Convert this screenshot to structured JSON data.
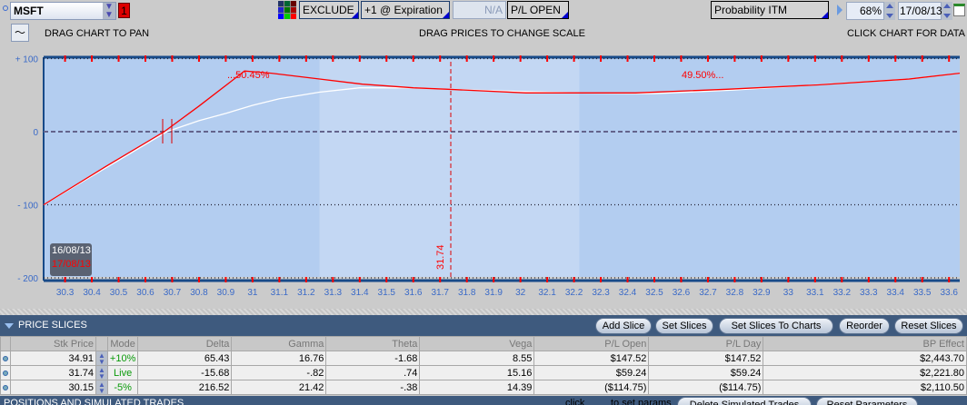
{
  "toolbar": {
    "symbol": "MSFT",
    "badge": "1",
    "exclude": "EXCLUDE",
    "expiration": "+1 @ Expiration",
    "na": "N/A",
    "pl_mode": "P/L OPEN",
    "prob": "Probability ITM",
    "pct": "68%",
    "date": "17/08/13"
  },
  "hints": {
    "pan": "DRAG CHART TO PAN",
    "scale": "DRAG PRICES TO CHANGE SCALE",
    "data": "CLICK CHART FOR DATA"
  },
  "chart_data": {
    "type": "line",
    "xlim": [
      30.22,
      33.64
    ],
    "ylim": [
      -200,
      100
    ],
    "x_ticks": [
      "30.3",
      "30.4",
      "30.5",
      "30.6",
      "30.7",
      "30.8",
      "30.9",
      "31",
      "31.1",
      "31.2",
      "31.3",
      "31.4",
      "31.5",
      "31.6",
      "31.7",
      "31.8",
      "31.9",
      "32",
      "32.1",
      "32.2",
      "32.3",
      "32.4",
      "32.5",
      "32.6",
      "32.7",
      "32.8",
      "32.9",
      "33",
      "33.1",
      "33.2",
      "33.3",
      "33.4",
      "33.5",
      "33.6"
    ],
    "y_ticks": [
      {
        "v": 100,
        "label": "+ 100"
      },
      {
        "v": 0,
        "label": "0"
      },
      {
        "v": -100,
        "label": "- 100"
      },
      {
        "v": -200,
        "label": "- 200"
      }
    ],
    "prob_range": [
      31.25,
      32.22
    ],
    "current_price": 31.74,
    "current_price_label": "31.74",
    "prob_left_label": "...50.45%",
    "prob_right_label": "49.50%...",
    "legend": [
      "16/08/13",
      "17/08/13"
    ],
    "series": [
      {
        "name": "16/08/13",
        "color": "#ffffff",
        "points": [
          [
            30.22,
            -100
          ],
          [
            30.45,
            -50
          ],
          [
            30.68,
            0
          ],
          [
            30.8,
            15
          ],
          [
            30.9,
            25
          ],
          [
            31.0,
            36
          ],
          [
            31.1,
            45
          ],
          [
            31.25,
            54
          ],
          [
            31.4,
            60
          ],
          [
            31.6,
            60
          ],
          [
            31.73,
            58
          ],
          [
            32.0,
            55
          ],
          [
            32.2,
            53
          ],
          [
            32.5,
            52
          ],
          [
            32.8,
            57
          ],
          [
            33.1,
            64
          ],
          [
            33.45,
            72
          ],
          [
            33.64,
            80
          ]
        ]
      },
      {
        "name": "17/08/13",
        "color": "#ff0000",
        "points": [
          [
            30.22,
            -100
          ],
          [
            30.45,
            -48
          ],
          [
            30.67,
            0
          ],
          [
            30.8,
            35
          ],
          [
            30.97,
            83
          ],
          [
            31.07,
            80
          ],
          [
            31.25,
            72
          ],
          [
            31.41,
            65
          ],
          [
            31.6,
            60
          ],
          [
            31.73,
            58
          ],
          [
            32.02,
            53
          ],
          [
            32.43,
            53
          ],
          [
            32.77,
            58
          ],
          [
            33.11,
            64
          ],
          [
            33.45,
            72
          ],
          [
            33.64,
            80
          ]
        ]
      }
    ]
  },
  "slices": {
    "title": "PRICE SLICES",
    "buttons": [
      "Add Slice",
      "Set Slices",
      "Set Slices To Charts",
      "Reorder",
      "Reset Slices"
    ],
    "columns": [
      "Stk Price",
      "Mode",
      "Delta",
      "Gamma",
      "Theta",
      "Vega",
      "P/L Open",
      "P/L Day",
      "BP Effect"
    ],
    "rows": [
      [
        "34.91",
        "+10%",
        "65.43",
        "16.76",
        "-1.68",
        "8.55",
        "$147.52",
        "$147.52",
        "$2,443.70"
      ],
      [
        "31.74",
        "Live",
        "-15.68",
        "-.82",
        ".74",
        "15.16",
        "$59.24",
        "$59.24",
        "$2,221.80"
      ],
      [
        "30.15",
        "-5%",
        "216.52",
        "21.42",
        "-.38",
        "14.39",
        "($114.75)",
        "($114.75)",
        "$2,110.50"
      ]
    ]
  },
  "positions": {
    "title": "POSITIONS AND SIMULATED TRADES",
    "hint_pre": "click",
    "hint_post": "to set params",
    "delete": "Delete Simulated Trades",
    "reset": "Reset Parameters"
  }
}
